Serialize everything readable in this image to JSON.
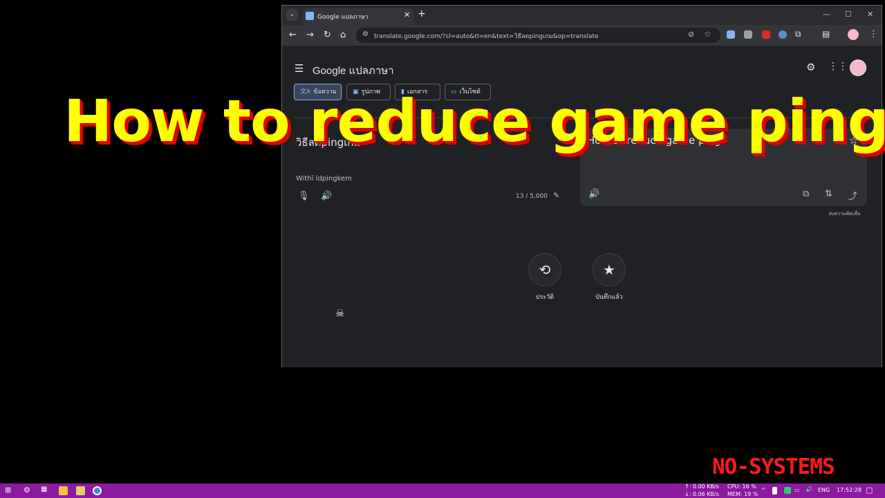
{
  "overlay": {
    "title": "How to reduce game ping",
    "watermark": "NO-SYSTEMS"
  },
  "browser": {
    "tab_title": "Google แปลภาษา",
    "url": "translate.google.com/?sl=auto&tl=en&text=วิธีลดpingเกม&op=translate",
    "window_controls": {
      "minimize": "—",
      "maximize": "☐",
      "close": "✕"
    }
  },
  "translate": {
    "logo_text": "Google",
    "logo_suffix": "แปลภาษา",
    "modes": [
      {
        "label": "ข้อความ",
        "icon": "translate-icon"
      },
      {
        "label": "รูปภาพ",
        "icon": "image-icon"
      },
      {
        "label": "เอกสาร",
        "icon": "document-icon"
      },
      {
        "label": "เว็บไซต์",
        "icon": "website-icon"
      }
    ],
    "source": {
      "text": "วิธีลดpingเกม",
      "transliteration": "Withī ldpingkem",
      "char_count": "13 / 5,000"
    },
    "target": {
      "text": "How to reduce game ping"
    },
    "feedback": "ส่งความคิดเห็น",
    "history_label": "ประวัติ",
    "saved_label": "บันทึกแล้ว"
  },
  "taskbar": {
    "net_up": "↑: 0.00 KB/s",
    "net_down": "↓: 0.06 KB/s",
    "cpu": "CPU: 16 %",
    "mem": "MEM: 19 %",
    "lang": "ENG",
    "time": "17:52:28"
  },
  "colors": {
    "overlay_fill": "#ffff00",
    "overlay_shadow": "#e00000",
    "taskbar": "#8b1a9e",
    "accent": "#8ab4f8"
  }
}
